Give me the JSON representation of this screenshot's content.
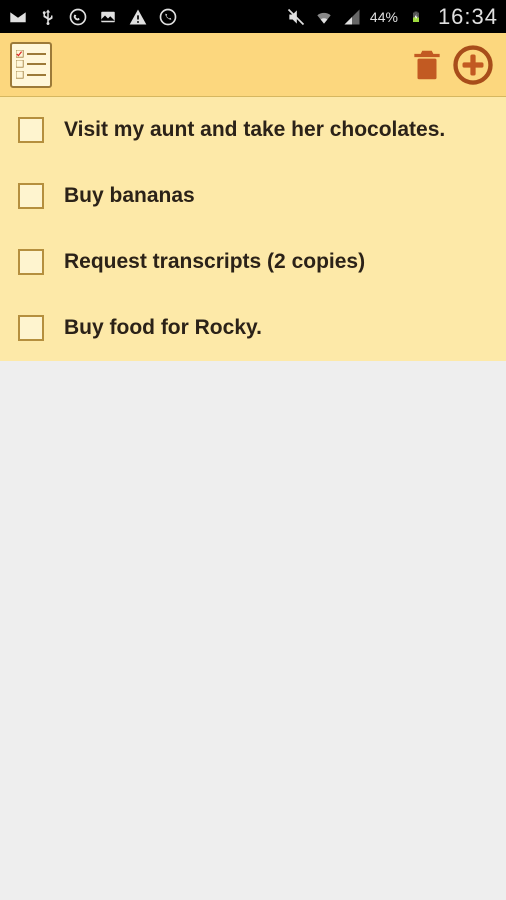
{
  "status_bar": {
    "battery_pct": "44%",
    "time": "16:34"
  },
  "todos": [
    {
      "text": "Visit my aunt and take her chocolates.",
      "checked": false
    },
    {
      "text": "Buy bananas",
      "checked": false
    },
    {
      "text": "Request transcripts (2 copies)",
      "checked": false
    },
    {
      "text": "Buy food for Rocky.",
      "checked": false
    }
  ],
  "colors": {
    "header_bg": "#fcd77e",
    "list_bg": "#fde9a8",
    "accent": "#c25a22"
  }
}
